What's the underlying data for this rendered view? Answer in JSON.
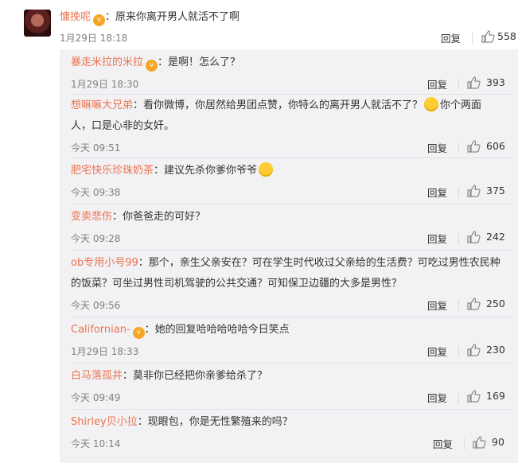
{
  "top_comment": {
    "username": "慵挽呢",
    "text": "：原来你离开男人就活不了啊",
    "time": "1月29日 18:18",
    "reply_label": "回复",
    "likes": "558"
  },
  "replies": [
    {
      "username": "暴走米拉的米拉",
      "has_badge": true,
      "text": "：是啊！怎么了？",
      "time": "1月29日 18:30",
      "reply_label": "回复",
      "likes": "393"
    },
    {
      "username": "想嘛嘛大兄弟",
      "text_line1": "：看你微博，你居然给男团点赞，你特么的离开男人就活不了？",
      "text_line1b": "你个两面",
      "text_line2": "人，口是心非的女奸。",
      "time": "今天 09:51",
      "reply_label": "回复",
      "likes": "606"
    },
    {
      "username": "肥宅快乐珍珠奶茶",
      "text": "：建议先杀你爹你爷爷",
      "time": "今天 09:38",
      "reply_label": "回复",
      "likes": "375"
    },
    {
      "username": "变卖悲伤",
      "text": "：你爸爸走的可好？",
      "time": "今天 09:28",
      "reply_label": "回复",
      "likes": "242"
    },
    {
      "username": "ob专用小号99",
      "text_line1": "：那个，亲生父亲安在？可在学生时代收过父亲给的生活费？可吃过男性农民种",
      "text_line2": "的饭菜？可坐过男性司机驾驶的公共交通？可知保卫边疆的大多是男性？",
      "time": "今天 09:56",
      "reply_label": "回复",
      "likes": "250"
    },
    {
      "username": "Californian-",
      "has_badge": true,
      "text": "：她的回复哈哈哈哈哈今日笑点",
      "time": "1月29日 18:33",
      "reply_label": "回复",
      "likes": "230"
    },
    {
      "username": "白马落孤井",
      "text": "：莫非你已经把你亲爹给杀了？",
      "time": "今天 09:49",
      "reply_label": "回复",
      "likes": "169"
    },
    {
      "username": "Shirley贝小拉",
      "text": "：现眼包，你是无性繁殖来的吗？",
      "time": "今天 10:14",
      "reply_label": "回复",
      "likes": "90"
    }
  ],
  "icons": {
    "like": "thumbs-up-icon",
    "badge": "vip-badge-icon"
  },
  "colors": {
    "username": "#eb7350",
    "sub_background": "#f2f2f5"
  }
}
